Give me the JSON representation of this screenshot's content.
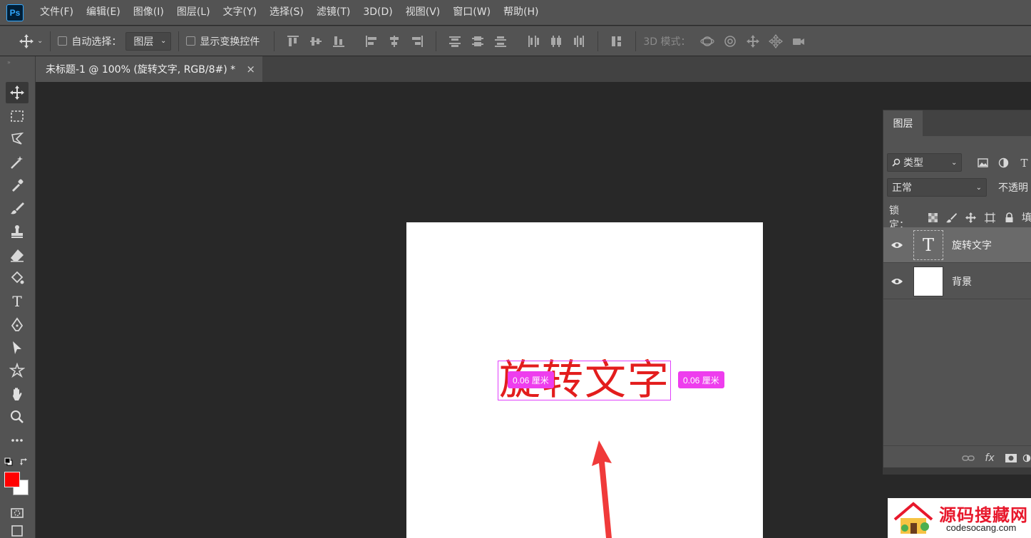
{
  "app": {
    "logo_text": "Ps"
  },
  "menu": [
    "文件(F)",
    "编辑(E)",
    "图像(I)",
    "图层(L)",
    "文字(Y)",
    "选择(S)",
    "滤镜(T)",
    "3D(D)",
    "视图(V)",
    "窗口(W)",
    "帮助(H)"
  ],
  "options_bar": {
    "auto_select_label": "自动选择：",
    "auto_select_value": "图层",
    "show_transform_label": "显示变换控件",
    "mode_3d_label": "3D 模式："
  },
  "document_tab": {
    "title": "未标题-1 @ 100% (旋转文字, RGB/8#) *",
    "close": "×"
  },
  "canvas": {
    "text": "旋转文字",
    "text_color": "#e31d1d",
    "measure_left": "0.06 厘米",
    "measure_right": "0.06 厘米",
    "measure_color": "#ee3dee",
    "arrow_color": "#f03a3a"
  },
  "colors": {
    "foreground": "#ff0000",
    "background": "#ffffff"
  },
  "layers_panel": {
    "tab_label": "图层",
    "filter_kind": "类型",
    "blend_mode": "正常",
    "opacity_label": "不透明",
    "lock_label": "锁定：",
    "fill_label": "填",
    "layers": [
      {
        "name": "旋转文字",
        "type": "text",
        "thumb_glyph": "T",
        "selected": true
      },
      {
        "name": "背景",
        "type": "background",
        "selected": false
      }
    ],
    "footer_fx": "fx"
  },
  "watermark": {
    "title": "源码搜藏网",
    "url": "codesocang.com"
  }
}
